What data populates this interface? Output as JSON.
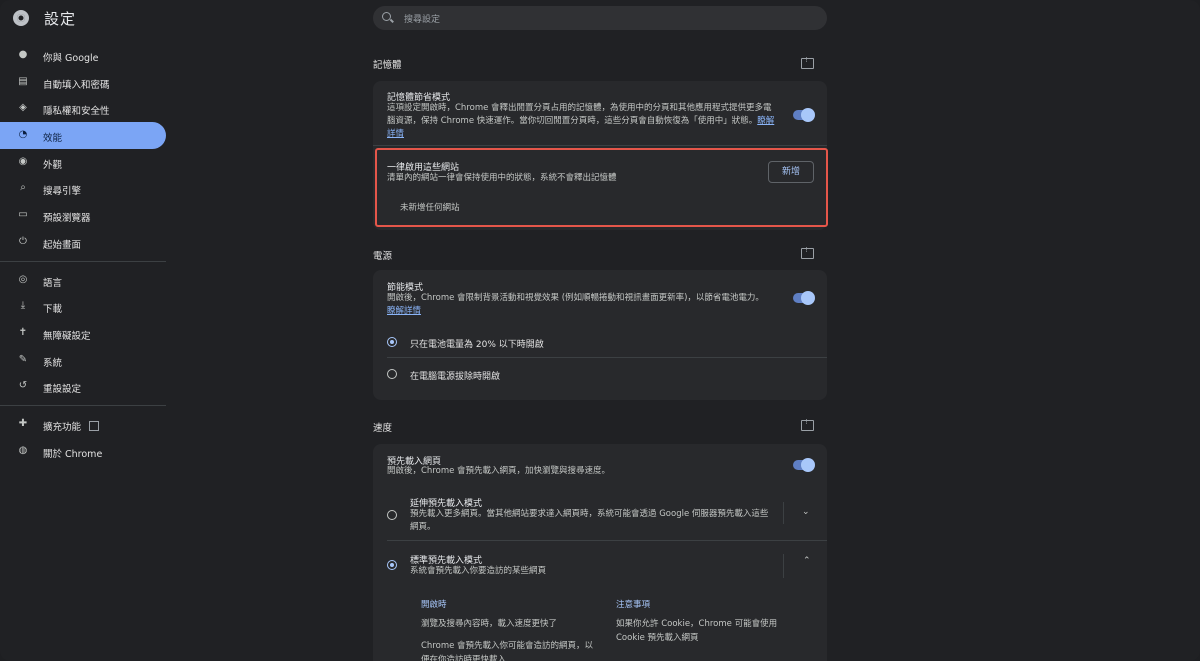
{
  "app": {
    "title": "設定"
  },
  "search": {
    "placeholder": "搜尋設定"
  },
  "sidebar": {
    "items": [
      {
        "label": "你與 Google",
        "icon": "person-icon"
      },
      {
        "label": "自動填入和密碼",
        "icon": "clipboard-icon"
      },
      {
        "label": "隱私權和安全性",
        "icon": "shield-icon"
      },
      {
        "label": "效能",
        "icon": "speedometer-icon",
        "active": true
      },
      {
        "label": "外觀",
        "icon": "palette-icon"
      },
      {
        "label": "搜尋引擎",
        "icon": "search-icon"
      },
      {
        "label": "預設瀏覽器",
        "icon": "browser-icon"
      },
      {
        "label": "起始畫面",
        "icon": "power-icon"
      },
      {
        "label": "語言",
        "icon": "globe-icon"
      },
      {
        "label": "下載",
        "icon": "download-icon"
      },
      {
        "label": "無障礙設定",
        "icon": "accessibility-icon"
      },
      {
        "label": "系統",
        "icon": "wrench-icon"
      },
      {
        "label": "重設設定",
        "icon": "restore-icon"
      },
      {
        "label": "擴充功能",
        "icon": "puzzle-icon"
      },
      {
        "label": "關於 Chrome",
        "icon": "chrome-icon"
      }
    ]
  },
  "memory": {
    "section_title": "記憶體",
    "saver_title": "記憶體節省模式",
    "saver_desc": "這項設定開啟時，Chrome 會釋出閒置分頁占用的記憶體，為使用中的分頁和其他應用程式提供更多電腦資源，保持 Chrome 快速運作。當你切回閒置分頁時，這些分頁會自動恢復為「使用中」狀態。",
    "saver_link": "瞭解詳情",
    "saver_enabled": true,
    "always_active_title": "一律啟用這些網站",
    "always_active_desc": "清單內的網站一律會保持使用中的狀態，系統不會釋出記憶體",
    "add_button": "新增",
    "empty_text": "未新增任何網站"
  },
  "power": {
    "section_title": "電源",
    "saver_title": "節能模式",
    "saver_desc": "開啟後，Chrome 會限制背景活動和視覺效果 (例如順暢捲動和視訊畫面更新率)，以節省電池電力。",
    "saver_link": "瞭解詳情",
    "saver_enabled": true,
    "option1": "只在電池電量為 20% 以下時開啟",
    "option2": "在電腦電源拔除時開啟",
    "selected_option": 1
  },
  "speed": {
    "section_title": "速度",
    "preload_title": "預先載入網頁",
    "preload_desc": "開啟後，Chrome 會預先載入網頁，加快瀏覽與搜尋速度。",
    "preload_enabled": true,
    "extended_title": "延伸預先載入模式",
    "extended_desc": "預先載入更多網頁。當其他網站要求達入網頁時，系統可能會透過 Google 伺服器預先載入這些網頁。",
    "standard_title": "標準預先載入模式",
    "standard_desc": "系統會預先載入你要造訪的某些網頁",
    "selected_option": 2,
    "when_on_head": "開啟時",
    "when_on_1": "瀏覽及搜尋內容時，載入速度更快了",
    "when_on_2": "Chrome 會預先載入你可能會造訪的網頁，以便在你造訪時更快載入",
    "notes_head": "注意事項",
    "notes_1": "如果你允許 Cookie，Chrome 可能會使用 Cookie 預先載入網頁"
  },
  "colors": {
    "accent": "#a8c7fa",
    "active_nav": "#7ba5f5",
    "highlight": "#e5564a"
  }
}
